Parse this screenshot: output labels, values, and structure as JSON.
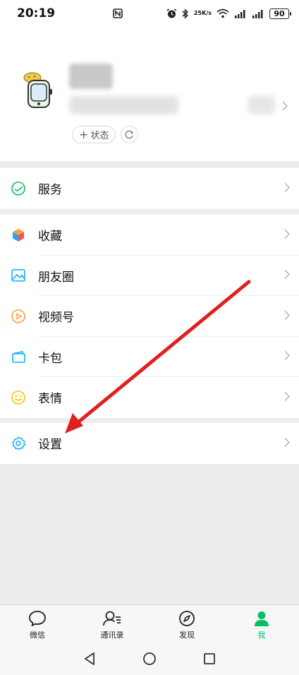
{
  "status_bar": {
    "time": "20:19",
    "speed_value": "25",
    "speed_unit": "K/s",
    "battery": "90"
  },
  "profile": {
    "status_label": "状态"
  },
  "menu": {
    "service": "服务",
    "favorites": "收藏",
    "moments": "朋友圈",
    "channels": "视频号",
    "cards": "卡包",
    "stickers": "表情",
    "settings": "设置"
  },
  "tabs": [
    {
      "label": "微信",
      "icon": "chat-bubble-icon",
      "active": false
    },
    {
      "label": "通讯录",
      "icon": "contacts-icon",
      "active": false
    },
    {
      "label": "发现",
      "icon": "compass-icon",
      "active": false
    },
    {
      "label": "我",
      "icon": "person-icon",
      "active": true
    }
  ],
  "colors": {
    "accent_green": "#07c160",
    "annotation_red": "#e02020",
    "background": "#ededed"
  }
}
